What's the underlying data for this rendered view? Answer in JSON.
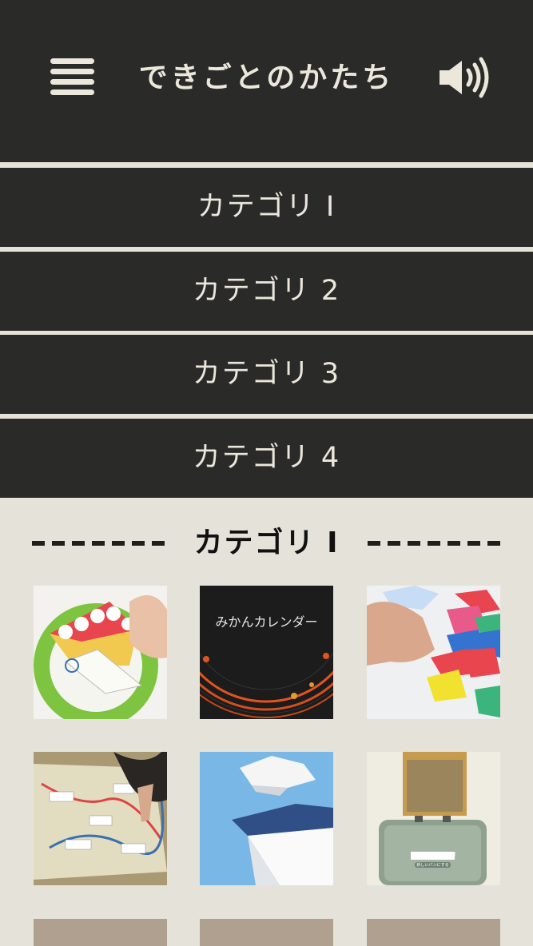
{
  "header": {
    "title": "できごとのかたち",
    "menu_icon": "hamburger-menu-icon",
    "sound_icon": "speaker-volume-icon"
  },
  "menu": {
    "items": [
      {
        "label": "カテゴリ I"
      },
      {
        "label": "カテゴリ 2"
      },
      {
        "label": "カテゴリ 3"
      },
      {
        "label": "カテゴリ 4"
      }
    ]
  },
  "section": {
    "title": "カテゴリ I",
    "thumbnails": [
      {
        "name": "cake-slice-thumbnail",
        "caption": ""
      },
      {
        "name": "mikan-calendar-thumbnail",
        "caption": "みかんカレンダー"
      },
      {
        "name": "puzzle-pieces-thumbnail",
        "caption": ""
      },
      {
        "name": "map-thumbnail",
        "caption": ""
      },
      {
        "name": "floating-island-thumbnail",
        "caption": ""
      },
      {
        "name": "toaster-thumbnail",
        "caption": "",
        "toaster_label": "TOAST",
        "toaster_button": "新しいパンにする"
      }
    ]
  },
  "colors": {
    "dark": "#2a2b29",
    "cream": "#ebe7db",
    "background": "#e5e3d9",
    "placeholder": "#b0a08f"
  }
}
